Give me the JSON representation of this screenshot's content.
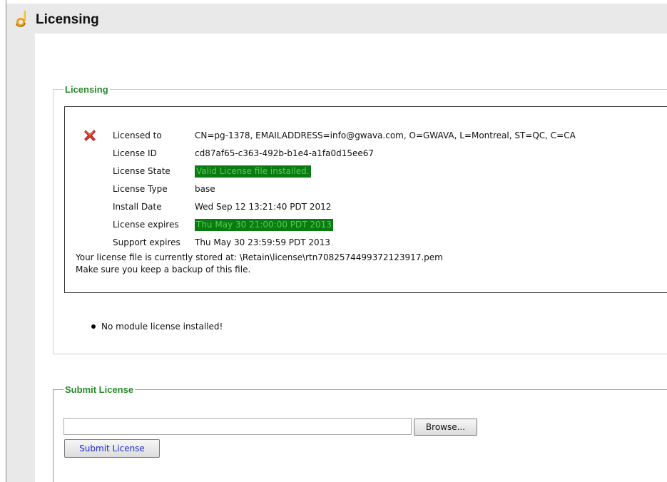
{
  "header": {
    "title": "Licensing",
    "icon": "key-icon"
  },
  "licensing_panel": {
    "legend": "Licensing",
    "status_icon": "red-x-icon",
    "rows": [
      {
        "label": "Licensed to",
        "value": "CN=pg-1378, EMAILADDRESS=info@gwava.com, O=GWAVA, L=Montreal, ST=QC, C=CA",
        "highlight": false
      },
      {
        "label": "License ID",
        "value": "cd87af65-c363-492b-b1e4-a1fa0d15ee67",
        "highlight": false
      },
      {
        "label": "License State",
        "value": "Valid License file installed.",
        "highlight": true
      },
      {
        "label": "License Type",
        "value": "base",
        "highlight": false
      },
      {
        "label": "Install Date",
        "value": "Wed Sep 12 13:21:40 PDT 2012",
        "highlight": false
      },
      {
        "label": "License expires",
        "value": "Thu May 30 21:00:00 PDT 2013",
        "highlight": true
      },
      {
        "label": "Support expires",
        "value": "Thu May 30 23:59:59 PDT 2013",
        "highlight": false
      }
    ],
    "stored_note_line1": "Your license file is currently stored at: \\Retain\\license\\rtn7082574499372123917.pem",
    "stored_note_line2": "Make sure you keep a backup of this file.",
    "module_note": "No module license installed!"
  },
  "submit_panel": {
    "legend": "Submit License",
    "file_value": "",
    "browse_label": "Browse...",
    "submit_label": "Submit License"
  },
  "colors": {
    "legend_green": "#2a8a2a",
    "highlight_bg": "#0b7a12",
    "highlight_text": "#4cd24c",
    "submit_text": "#1a2ad0"
  }
}
